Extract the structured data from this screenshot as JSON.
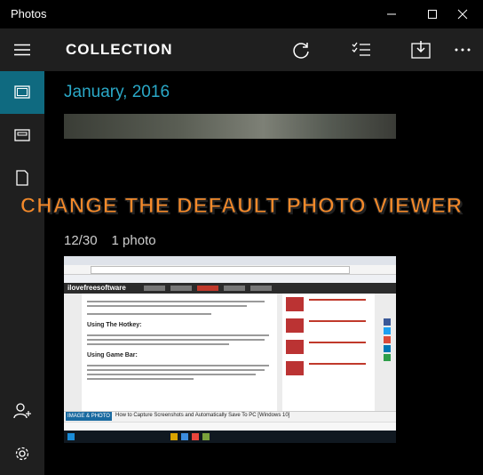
{
  "window": {
    "title": "Photos",
    "controls": {
      "minimize": "minimize-icon",
      "maximize": "maximize-icon",
      "close": "close-icon"
    }
  },
  "sidebar": {
    "items": [
      {
        "name": "hamburger-menu",
        "icon": "hamburger-icon"
      },
      {
        "name": "collection",
        "icon": "photo-icon",
        "active": true
      },
      {
        "name": "albums",
        "icon": "album-icon"
      },
      {
        "name": "folders",
        "icon": "folder-icon"
      },
      {
        "name": "sign-in",
        "icon": "person-add-icon"
      },
      {
        "name": "settings",
        "icon": "gear-icon"
      }
    ]
  },
  "toolbar": {
    "section_title": "COLLECTION",
    "buttons": [
      {
        "name": "refresh",
        "icon": "refresh-icon"
      },
      {
        "name": "select",
        "icon": "select-icon"
      },
      {
        "name": "import",
        "icon": "import-icon"
      },
      {
        "name": "more",
        "icon": "more-icon"
      }
    ]
  },
  "content": {
    "month_heading": "January, 2016",
    "group_date": "12/30",
    "group_count": "1 photo"
  },
  "overlay": {
    "caption": "CHANGE THE DEFAULT PHOTO VIEWER"
  },
  "screenshot_thumb": {
    "site_name": "ilovefreesoftware",
    "article_heading_1": "Using The Hotkey:",
    "article_heading_2": "Using Game Bar:",
    "footer_tag": "IMAGE & PHOTO",
    "footer_text": "How to Capture Screenshots and Automatically Save To PC [Windows 10]"
  },
  "colors": {
    "accent": "#0f6a80",
    "month_text": "#2aa8c7",
    "overlay_text": "#f58a2a",
    "chrome": "#1f1f1f"
  }
}
